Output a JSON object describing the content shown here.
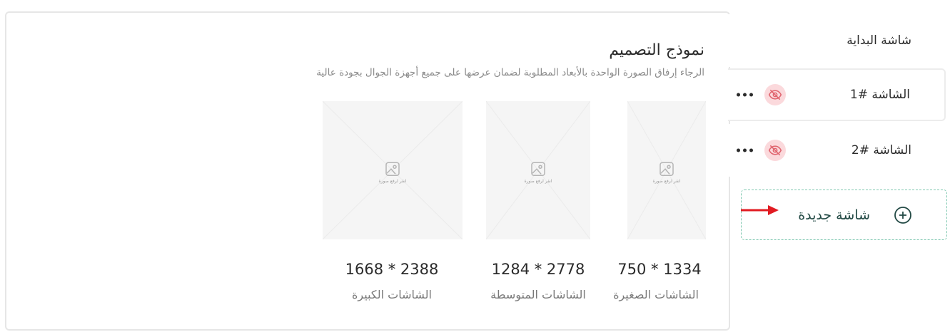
{
  "design_panel": {
    "title": "نموذج التصميم",
    "subtitle": "الرجاء إرفاق الصورة الواحدة بالأبعاد المطلوبة لضمان عرضها على جميع أجهزة الجوال بجودة عالية",
    "cards": [
      {
        "dims": "750 * 1334",
        "label": "الشاشات الصغيرة",
        "upload_hint": "انقر لرفع صورة"
      },
      {
        "dims": "1284 * 2778",
        "label": "الشاشات المتوسطة",
        "upload_hint": "انقر لرفع صورة"
      },
      {
        "dims": "1668 * 2388",
        "label": "الشاشات الكبيرة",
        "upload_hint": "انقر لرفع صورة"
      }
    ]
  },
  "sidebar": {
    "items": [
      {
        "label": "شاشة البداية"
      },
      {
        "label": "الشاشة #1",
        "active": true,
        "visibility_icon": "eye-off-icon",
        "menu_icon": "more-dots-icon"
      },
      {
        "label": "الشاشة #2",
        "active": false,
        "visibility_icon": "eye-off-icon",
        "menu_icon": "more-dots-icon"
      }
    ],
    "new_screen": {
      "label": "شاشة جديدة",
      "icon": "plus-circle-icon"
    }
  },
  "annotation": {
    "icon": "red-arrow-icon"
  },
  "colors": {
    "accent_dashed": "#7fc8b0",
    "accent_text": "#234a45",
    "eye_off_bg": "#fbd9dc",
    "eye_off_stroke": "#e0646e",
    "arrow": "#e11b22"
  }
}
